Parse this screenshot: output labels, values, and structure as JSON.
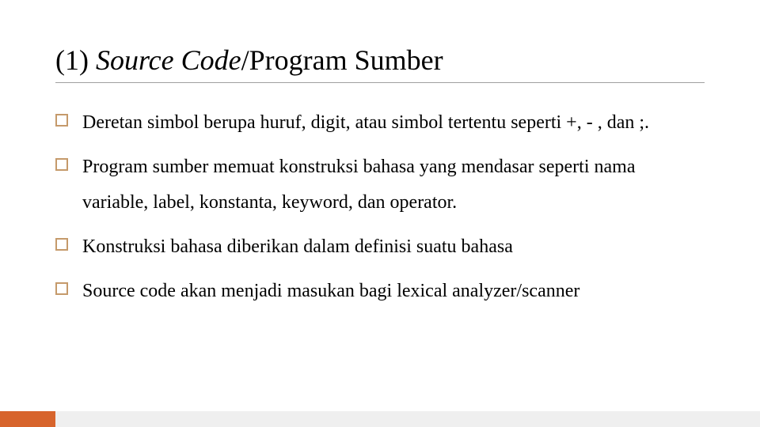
{
  "title": {
    "prefix": "(1) ",
    "italic": "Source Code",
    "suffix": "/Program Sumber"
  },
  "bullets": [
    "Deretan simbol berupa huruf, digit, atau simbol tertentu seperti +, - , dan ;.",
    "Program sumber memuat konstruksi bahasa yang mendasar seperti nama variable, label, konstanta, keyword, dan operator.",
    "Konstruksi bahasa diberikan dalam definisi suatu bahasa",
    "Source code akan menjadi masukan bagi lexical analyzer/scanner"
  ]
}
